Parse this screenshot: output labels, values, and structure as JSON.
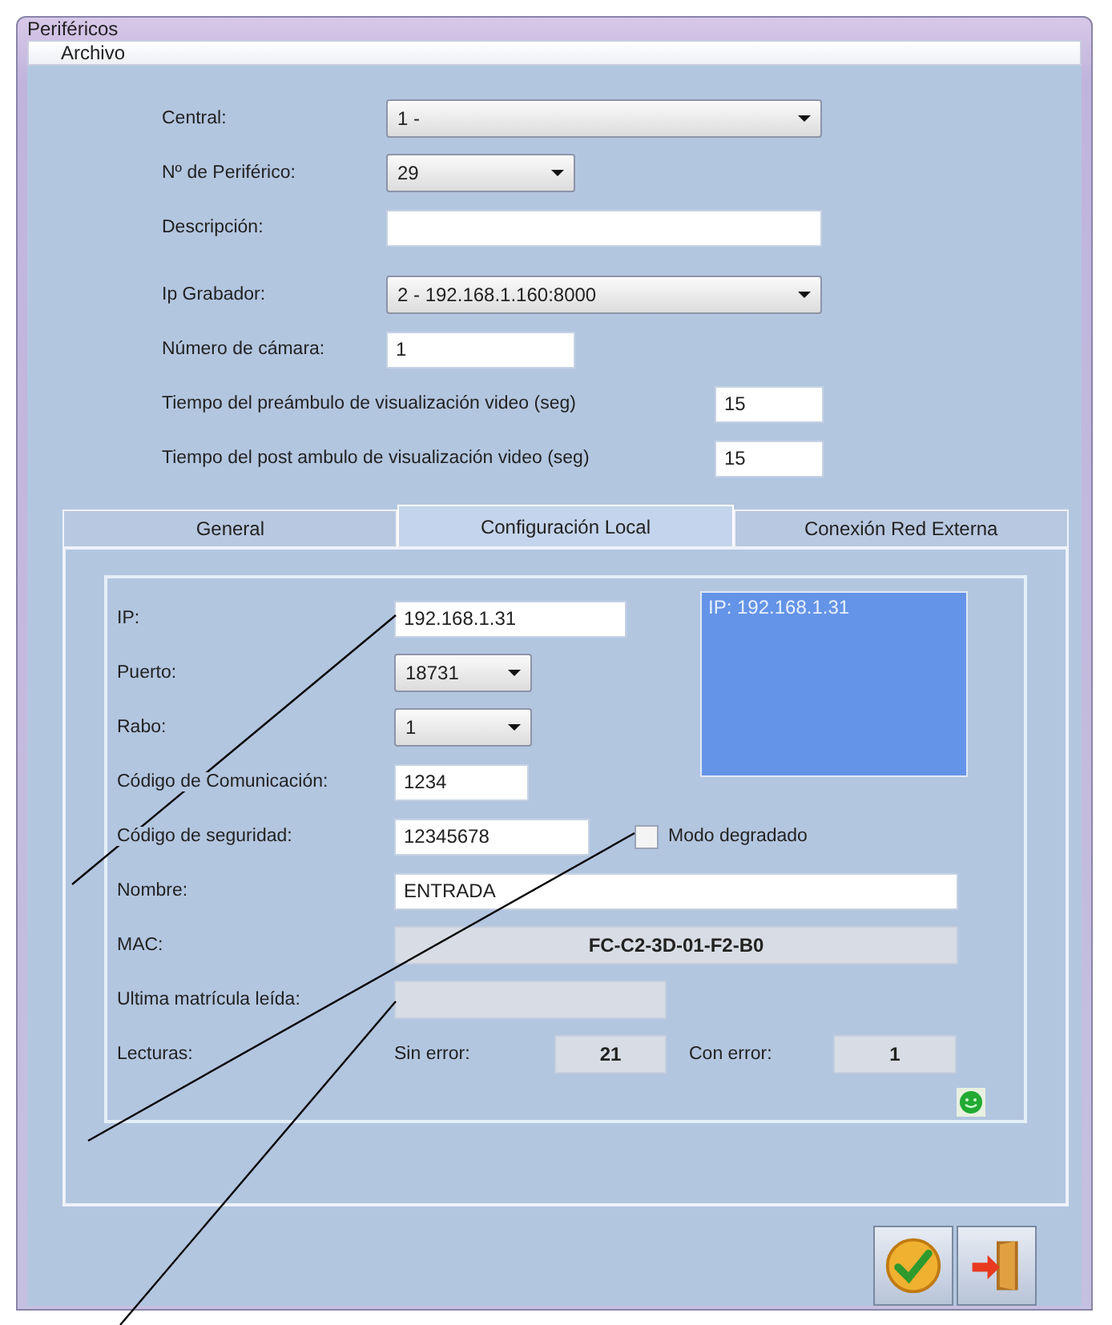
{
  "window": {
    "title": "Periféricos"
  },
  "menu": [
    "Archivo"
  ],
  "header": {
    "central": {
      "label": "Central:",
      "value": "1 -"
    },
    "peripheral": {
      "label": "Nº de Periférico:",
      "value": "29"
    },
    "description": {
      "label": "Descripción:"
    },
    "recorder": {
      "label": "Ip Grabador:",
      "value": "2 - 192.168.1.160:8000"
    },
    "camera": {
      "label": "Número de cámara:",
      "value": "1"
    },
    "preamble": {
      "label": "Tiempo del preámbulo de visualización video (seg)",
      "value": "15"
    },
    "postamble": {
      "label": "Tiempo del post ambulo de visualización video (seg)",
      "value": "15"
    }
  },
  "tabs": [
    {
      "label": "General",
      "selected": false
    },
    {
      "label": "Configuración Local",
      "selected": true
    },
    {
      "label": "Conexión Red Externa",
      "selected": false
    }
  ],
  "local": {
    "ip": {
      "label": "IP:",
      "value": "192.168.1.31"
    },
    "port": {
      "label": "Puerto:",
      "value": "18731"
    },
    "rabo": {
      "label": "Rabo:",
      "value": "1"
    },
    "comm_code": {
      "label": "Código de Comunicación:",
      "value": "1234"
    },
    "security_code": {
      "label": "Código de seguridad:",
      "value": "12345678"
    },
    "degraded": {
      "label": "Modo degradado",
      "checked": false
    },
    "name": {
      "label": "Nombre:",
      "value": "ENTRADA"
    },
    "mac": {
      "label": "MAC:",
      "value": "FC-C2-3D-01-F2-B0"
    },
    "last_plate": {
      "label": "Ultima matrícula leída:"
    },
    "ip_list": [
      "IP: 192.168.1.31"
    ],
    "readings": {
      "label": "Lecturas:",
      "ok_label": "Sin error:",
      "ok": "21",
      "err_label": "Con error:",
      "err": "1"
    }
  }
}
